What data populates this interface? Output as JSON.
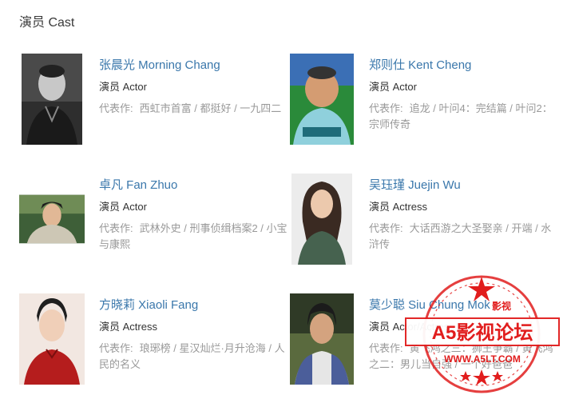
{
  "section": {
    "title": "演员 Cast"
  },
  "works_label": "代表作:",
  "cast": [
    {
      "name": "张晨光 Morning Chang",
      "role": "演员 Actor",
      "works": "西虹市首富 / 都挺好 / 一九四二"
    },
    {
      "name": "郑则仕 Kent Cheng",
      "role": "演员 Actor",
      "works": "追龙 / 叶问4：完结篇 / 叶问2：宗师传奇"
    },
    {
      "name": "卓凡 Fan Zhuo",
      "role": "演员 Actor",
      "works": "武林外史 / 刑事侦缉档案2 / 小宝与康熙"
    },
    {
      "name": "吴珏瑾 Juejin Wu",
      "role": "演员 Actress",
      "works": "大话西游之大圣娶亲 / 开端 / 水浒传"
    },
    {
      "name": "方晓莉 Xiaoli Fang",
      "role": "演员 Actress",
      "works": "琅琊榜 / 星汉灿烂·月升沧海 / 人民的名义"
    },
    {
      "name": "莫少聪 Siu Chung Mok",
      "role": "演员 Actor/Actress",
      "works": "黄飞鸿之三：狮王争霸 / 黄飞鸿之二：男儿当自强 / 一个好爸爸"
    }
  ],
  "watermark": {
    "top_text": "影视",
    "main_text": "A5影视论坛",
    "url": "WWW.A5LT.COM",
    "color": "#e11d1d"
  }
}
